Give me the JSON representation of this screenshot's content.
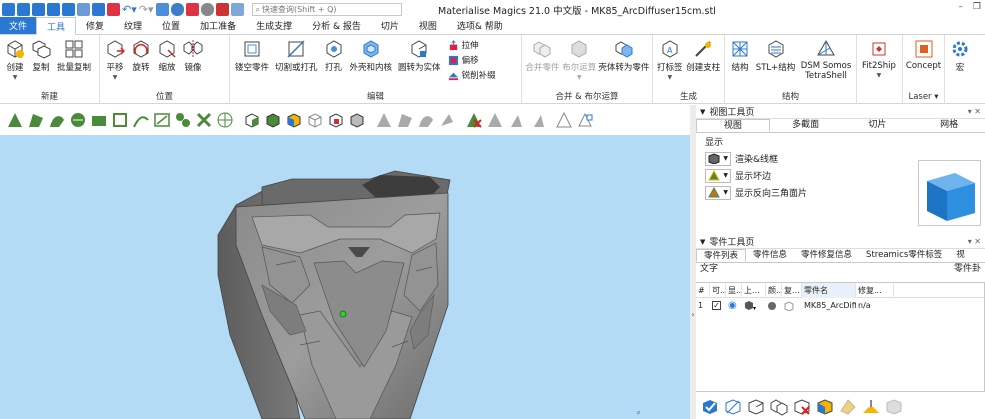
{
  "window": {
    "title": "Materialise Magics 21.0 中文版 - MK85_ArcDiffuser15cm.stl"
  },
  "search": {
    "placeholder": "快速查询(Shift + Q)"
  },
  "tabs": [
    {
      "label": "文件"
    },
    {
      "label": "工具"
    },
    {
      "label": "修复"
    },
    {
      "label": "纹理"
    },
    {
      "label": "位置"
    },
    {
      "label": "加工准备"
    },
    {
      "label": "生成支撑"
    },
    {
      "label": "分析 & 报告"
    },
    {
      "label": "切片"
    },
    {
      "label": "视图"
    },
    {
      "label": "选项& 帮助"
    }
  ],
  "ribbon": {
    "groups": [
      {
        "label": "新建",
        "buttons": [
          "创建",
          "复制",
          "批量复制"
        ]
      },
      {
        "label": "位置",
        "buttons": [
          "平移",
          "旋转",
          "缩放",
          "镜像"
        ]
      },
      {
        "label": "编辑",
        "buttons": [
          "镂空零件",
          "切割或打孔",
          "打孔",
          "外壳和内核",
          "圆转为实体"
        ],
        "small": [
          "拉伸",
          "偏移",
          "锐削补缀"
        ]
      },
      {
        "label": "合并 & 布尔运算",
        "buttons": [
          "合并零件",
          "布尔运算",
          "壳体转为零件"
        ]
      },
      {
        "label": "生成",
        "buttons": [
          "打标签",
          "创建支柱"
        ]
      },
      {
        "label": "结构",
        "buttons": [
          "结构",
          "STL+结构",
          "DSM Somos",
          "TetraShell"
        ]
      },
      {
        "label": "",
        "buttons": [
          "Fit2Ship"
        ]
      },
      {
        "label": "Laser",
        "buttons": [
          "Concept"
        ]
      },
      {
        "label": "",
        "buttons": [
          "宏"
        ]
      }
    ]
  },
  "view_panel": {
    "title": "视图工具页",
    "tabs": [
      "视图",
      "多截面",
      "切片",
      "网格"
    ],
    "display_label": "显示",
    "options": [
      "渲染&线框",
      "显示坏边",
      "显示反向三角面片"
    ]
  },
  "part_panel": {
    "title": "零件工具页",
    "tabs": [
      "零件列表",
      "零件信息",
      "零件修复信息",
      "Streamics零件标签",
      "视"
    ],
    "sub_label": "文字",
    "right_label": "零件卦",
    "columns": [
      "#",
      "可...",
      "显...",
      "上...",
      "颜...",
      "复...",
      "零件名",
      "修复..."
    ],
    "rows": [
      {
        "num": "1",
        "name": "MK85_ArcDiffu",
        "repair": "n/a"
      }
    ]
  },
  "colors": {
    "accent": "#2b78d2",
    "viewport": "#b4dbf5",
    "cube": "#2e8fe0"
  }
}
